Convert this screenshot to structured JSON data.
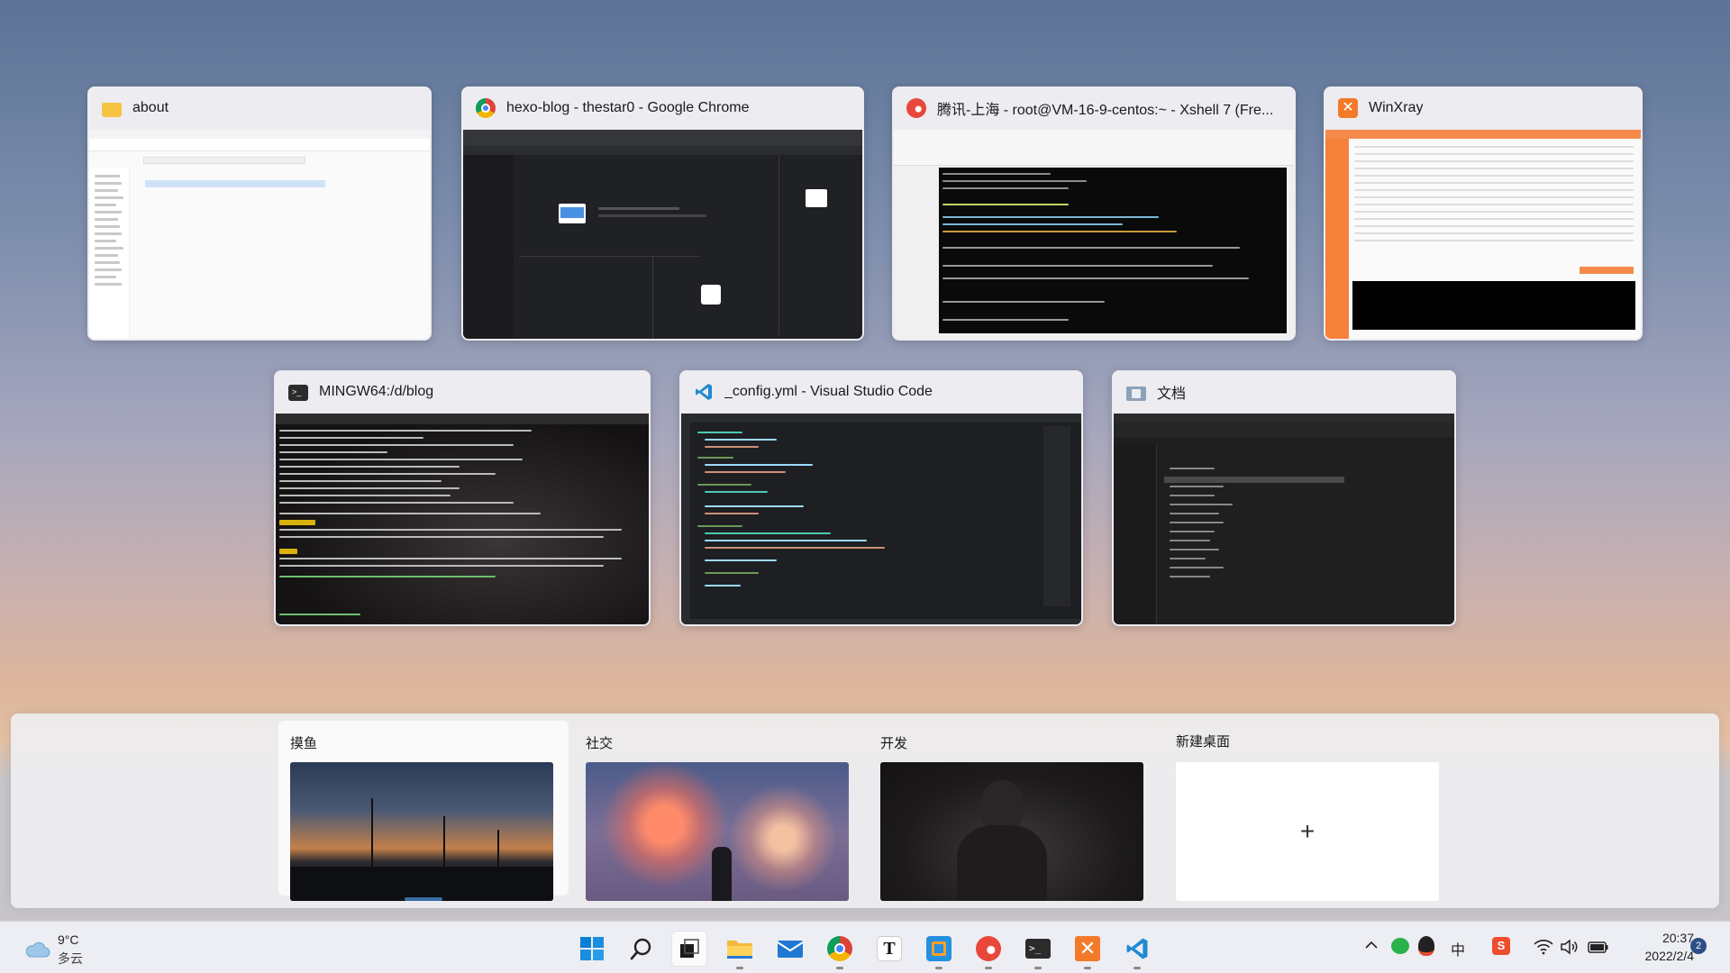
{
  "windows": [
    {
      "title": "about",
      "icon": "folder-icon"
    },
    {
      "title": "hexo-blog - thestar0 - Google Chrome",
      "icon": "chrome-icon"
    },
    {
      "title": "腾讯-上海 - root@VM-16-9-centos:~ - Xshell 7 (Fre...",
      "icon": "xshell-icon"
    },
    {
      "title": "WinXray",
      "icon": "winxray-icon"
    },
    {
      "title": "MINGW64:/d/blog",
      "icon": "terminal-icon"
    },
    {
      "title": "_config.yml - Visual Studio Code",
      "icon": "vscode-icon"
    },
    {
      "title": "文档",
      "icon": "documents-folder-icon"
    }
  ],
  "desktops": [
    {
      "label": "摸鱼",
      "active": true
    },
    {
      "label": "社交",
      "active": false
    },
    {
      "label": "开发",
      "active": false
    },
    {
      "label": "新建桌面",
      "add_symbol": "+"
    }
  ],
  "taskbar": {
    "weather": {
      "temp": "9°C",
      "condition": "多云"
    },
    "apps": [
      "start-icon",
      "search-icon",
      "task-view-icon",
      "file-explorer-icon",
      "mail-icon",
      "chrome-icon",
      "typora-icon",
      "remote-app-icon",
      "xshell-icon",
      "terminal-icon",
      "winxray-icon",
      "vscode-icon"
    ],
    "tray": {
      "ime": "中",
      "time": "20:37",
      "date": "2022/2/4",
      "notification_count": "2"
    }
  },
  "colors": {
    "accent": "#3a6ea5",
    "panel": "#eeeef0",
    "taskbar": "#eceef3"
  }
}
